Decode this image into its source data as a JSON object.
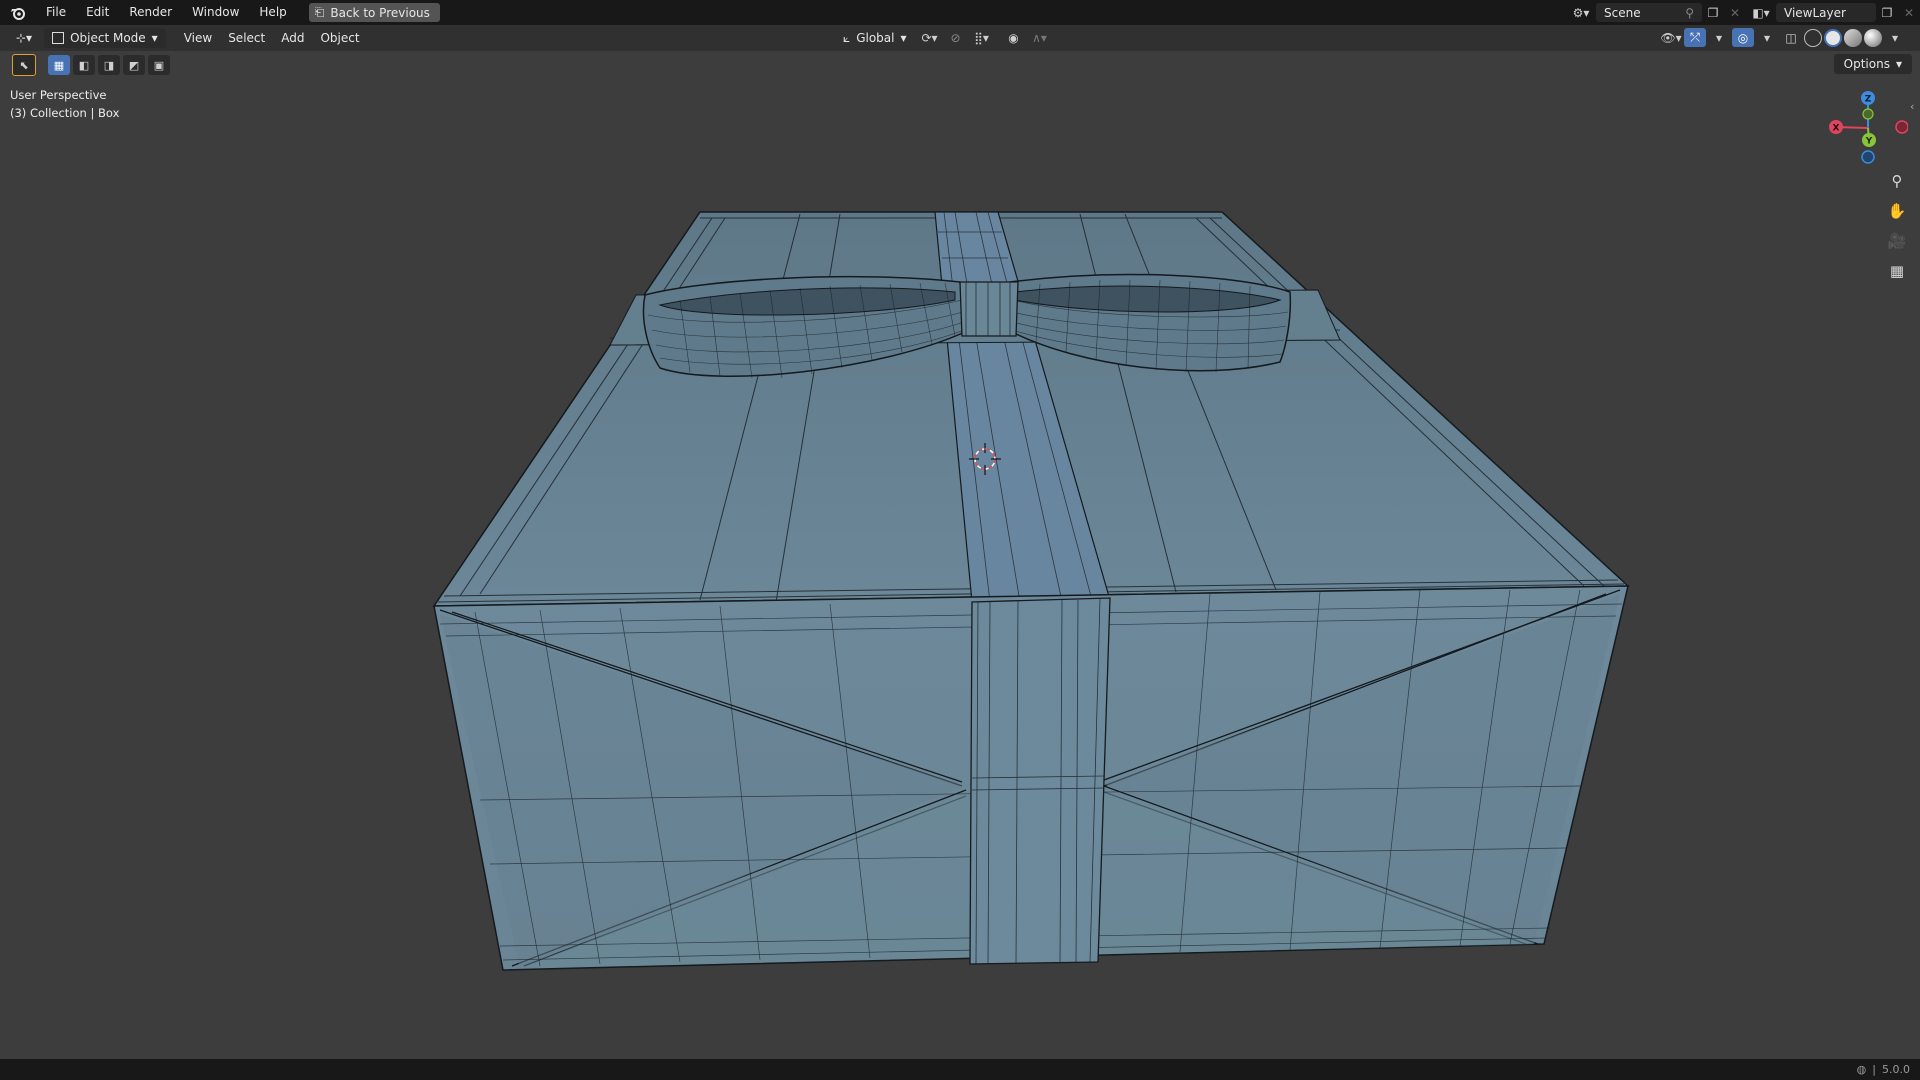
{
  "menubar": {
    "items": [
      "File",
      "Edit",
      "Render",
      "Window",
      "Help"
    ],
    "back_button": "Back to Previous",
    "scene": "Scene",
    "view_layer": "ViewLayer"
  },
  "viewport_header": {
    "mode": "Object Mode",
    "menus": [
      "View",
      "Select",
      "Add",
      "Object"
    ],
    "orientation": "Global",
    "options": "Options"
  },
  "overlay": {
    "view_name": "User Perspective",
    "collection": "(3) Collection | Box"
  },
  "gizmo": {
    "x": "X",
    "y": "Y",
    "z": "Z"
  },
  "status": {
    "version": "5.0.0"
  },
  "colors": {
    "viewport_bg": "#3d3d3d",
    "mesh_fill": "#6a8696",
    "wire": "#101418",
    "axis_x": "#e0455f",
    "axis_y": "#8ac43a",
    "axis_z": "#3c8ce0"
  },
  "icons": [
    "blender-logo-icon",
    "back-icon",
    "scene-icon",
    "pin-icon",
    "view-layer-icon",
    "zoom-icon",
    "pan-hand-icon",
    "camera-icon",
    "grid-view-icon",
    "cursor-icon",
    "globe-icon"
  ]
}
